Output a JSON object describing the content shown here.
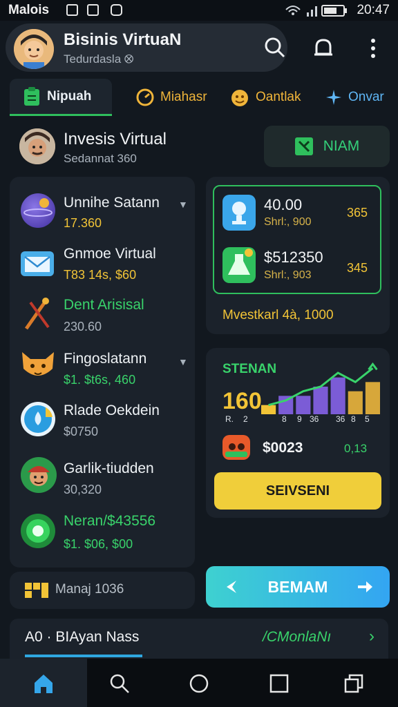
{
  "status_bar": {
    "left_text": "Malois",
    "time": "20:47"
  },
  "header": {
    "title": "Bisinis VirtuaN",
    "subtitle": "Tedurdasla ⭙"
  },
  "tabs": [
    {
      "label": "Nipuah",
      "icon": "clipboard-icon",
      "color": "#2fbf5d"
    },
    {
      "label": "Miahasr",
      "icon": "clock-icon",
      "color": "#f0b53a"
    },
    {
      "label": "Oantlak",
      "icon": "emoji-icon",
      "color": "#f0b53a"
    },
    {
      "label": "Onvar",
      "icon": "sparkle-icon",
      "color": "#5fb6f5"
    }
  ],
  "profile": {
    "name": "Invesis Virtual",
    "sub": "Sedannat 360",
    "button": "NIAM"
  },
  "list": [
    {
      "title": "Unnihe Satann",
      "sub": "17.360",
      "sub_color": "yellow",
      "icon": "planet-icon",
      "chevron": true
    },
    {
      "title": "Gnmoe Virtual",
      "sub": "T83 14s, $60",
      "sub_color": "yellow",
      "icon": "mail-icon",
      "chevron": false
    },
    {
      "title": "Dent Arisisal",
      "sub": "230.60",
      "sub_color": "grey",
      "icon": "tools-icon",
      "chevron": false,
      "title_green": true
    },
    {
      "title": "Fingoslatann",
      "sub": "$1. $t6s, 460",
      "sub_color": "green",
      "icon": "fox-icon",
      "chevron": true
    },
    {
      "title": "Rlade Oekdein",
      "sub": "$0750",
      "sub_color": "grey",
      "icon": "water-drop-icon",
      "chevron": false
    },
    {
      "title": "Garlik-tiudden",
      "sub": "30,320",
      "sub_color": "grey",
      "icon": "person-icon",
      "chevron": false
    },
    {
      "title": "Neran/$43556",
      "sub": "$1. $06, $00",
      "sub_color": "green",
      "icon": "ring-icon",
      "chevron": false,
      "title_green": true
    }
  ],
  "card1": {
    "rows": [
      {
        "value": "40.00",
        "sub": "Shrl:, 900",
        "num": "365",
        "icon": "trophy-icon"
      },
      {
        "value": "$512350",
        "sub": "Shrl:, 903",
        "num": "345",
        "icon": "potion-icon"
      }
    ],
    "footer": "Mvestkarl 4à, 1000"
  },
  "chart_card": {
    "title": "STENAN",
    "big_value": "160",
    "value_row": "$0023",
    "value_row2": "0,13",
    "button": "SEIVSENI"
  },
  "chart_data": {
    "type": "bar",
    "categories": [
      "R",
      "2",
      "8",
      "9",
      "36",
      "36",
      "8"
    ],
    "ticks": [
      "R.",
      "2",
      "8",
      "9",
      "36",
      "36",
      "8",
      "5"
    ],
    "values": [
      2,
      4,
      4,
      6,
      8,
      5,
      7
    ],
    "line": [
      2,
      3,
      5,
      6,
      9,
      7,
      10
    ],
    "colors": [
      "#f2c437",
      "#7b5cd6",
      "#7b5cd6",
      "#7b5cd6",
      "#7b5cd6",
      "#d7a73a",
      "#d7a73a"
    ],
    "title": "STENAN",
    "xlabel": "",
    "ylabel": "",
    "ylim": [
      0,
      12
    ]
  },
  "manaj": {
    "text": "Manaj 1036"
  },
  "bemam": {
    "label": "BEMAM"
  },
  "bottom_strip": {
    "left": "A0 · BIAyan Nass",
    "right": "/CMonlaNı"
  },
  "nav": [
    "home-icon",
    "search-icon",
    "circle-icon",
    "square-icon",
    "recent-apps-icon"
  ]
}
